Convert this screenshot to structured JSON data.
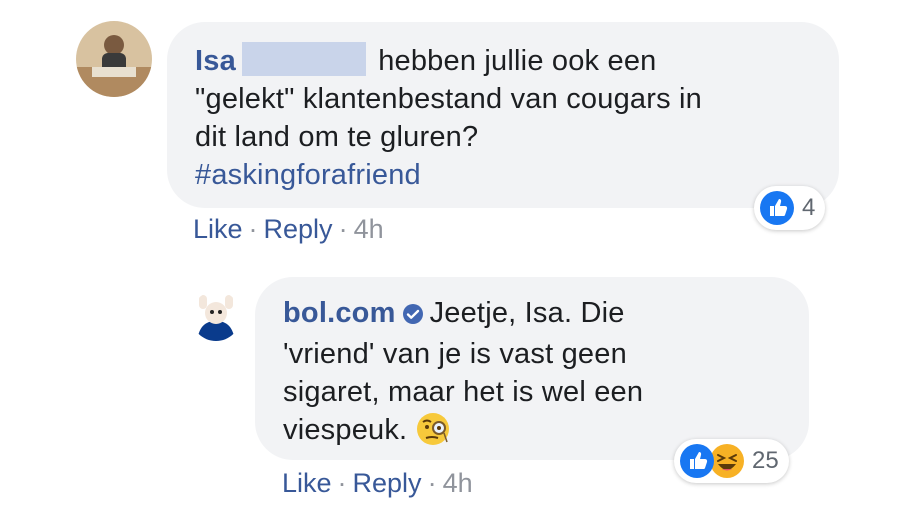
{
  "comments": [
    {
      "author": "Isa",
      "text_lines": [
        "hebben jullie ook een",
        "\"gelekt\" klantenbestand van cougars in",
        "dit land om te gluren?"
      ],
      "hashtag": "#askingforafriend",
      "actions": {
        "like": "Like",
        "reply": "Reply",
        "separator": "·",
        "time": "4h"
      },
      "reactions": {
        "count": "4",
        "types": [
          "like-icon"
        ]
      }
    },
    {
      "author": "bol.com",
      "verified": true,
      "text_lines": [
        "Jeetje, Isa. Die",
        "'vriend' van je is vast geen",
        "sigaret, maar het is wel een",
        "viespeuk."
      ],
      "emoji": "face-with-monocle-icon",
      "actions": {
        "like": "Like",
        "reply": "Reply",
        "separator": "·",
        "time": "4h"
      },
      "reactions": {
        "count": "25",
        "types": [
          "like-icon",
          "haha-icon"
        ]
      }
    }
  ],
  "colors": {
    "link": "#385898",
    "bubble": "#f2f3f5",
    "like": "#1877f2",
    "haha": "#f7b125",
    "meta": "#90949c"
  }
}
